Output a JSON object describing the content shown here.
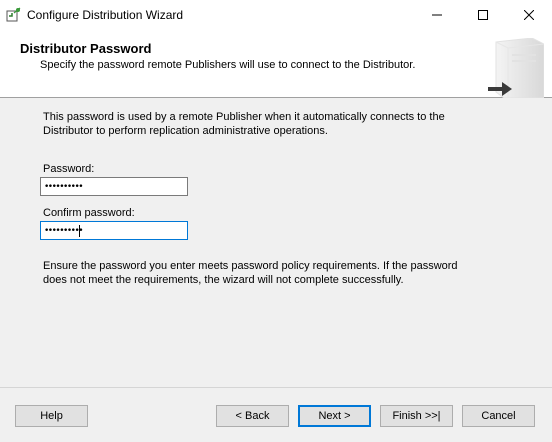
{
  "window": {
    "title": "Configure Distribution Wizard"
  },
  "header": {
    "title": "Distributor Password",
    "subtitle": "Specify the password remote Publishers will use to connect to the Distributor."
  },
  "intro": "This password is used by a remote Publisher when it automatically connects to the Distributor to perform replication administrative operations.",
  "fields": {
    "password_label": "Password:",
    "password_value": "••••••••••",
    "confirm_label": "Confirm password:",
    "confirm_value": "••••••••••"
  },
  "note": "Ensure the password you enter meets password policy requirements. If the password does not meet the requirements, the wizard will not complete successfully.",
  "buttons": {
    "help": "Help",
    "back": "< Back",
    "next": "Next >",
    "finish": "Finish >>|",
    "cancel": "Cancel"
  },
  "icons": {
    "app": "wizard-app-icon",
    "minimize": "minimize-icon",
    "maximize": "maximize-icon",
    "close": "close-icon",
    "header": "server-arrow-icon"
  }
}
